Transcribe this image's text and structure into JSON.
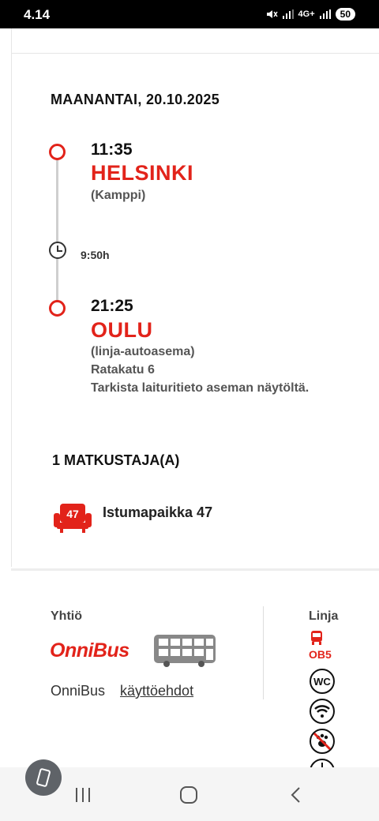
{
  "status_bar": {
    "time": "4.14",
    "network": "4G+",
    "battery": "50"
  },
  "trip": {
    "date": "MAANANTAI, 20.10.2025",
    "departure": {
      "time": "11:35",
      "city": "HELSINKI",
      "place": "(Kamppi)"
    },
    "duration": "9:50h",
    "arrival": {
      "time": "21:25",
      "city": "OULU",
      "place": "(linja-autoasema)",
      "address": "Ratakatu 6",
      "note": "Tarkista laituritieto aseman näytöltä."
    }
  },
  "passengers": {
    "title": "1 MATKUSTAJA(A)",
    "seat_number": "47",
    "seat_label": "Istumapaikka 47"
  },
  "company": {
    "label": "Yhtiö",
    "logo_text": "OnniBus",
    "name": "OnniBus",
    "terms_link": "käyttöehdot"
  },
  "line": {
    "label": "Linja",
    "code": "OB5",
    "wc_text": "WC",
    "icons": [
      "bus-icon",
      "wc-icon",
      "wifi-icon",
      "no-pets-icon",
      "power-outlet-icon"
    ]
  },
  "colors": {
    "accent": "#e2231a",
    "text": "#111111",
    "muted": "#555555"
  }
}
